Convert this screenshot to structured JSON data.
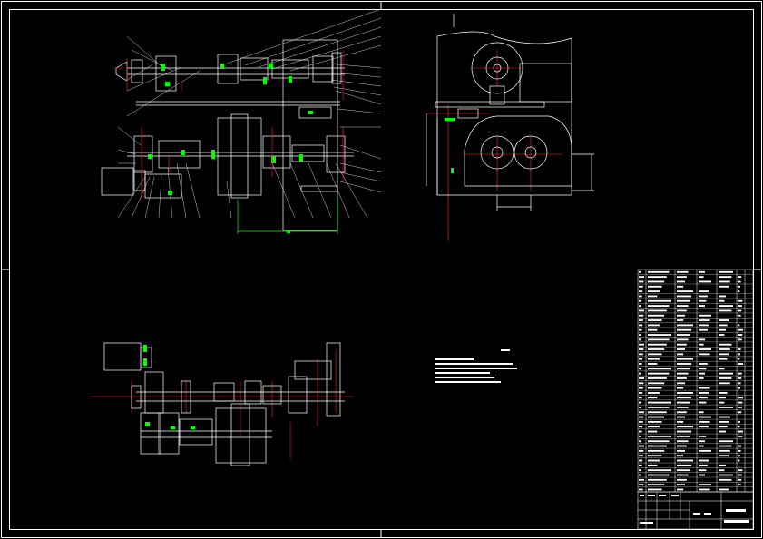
{
  "drawing": {
    "title_block": {
      "drawing_name": "",
      "drawing_code": ""
    },
    "tech_requirements": {
      "heading": "",
      "lines": []
    },
    "colors": {
      "background": "#000000",
      "linework": "#ffffff",
      "centerline": "#ff0000",
      "highlight": "#00ff00"
    }
  }
}
